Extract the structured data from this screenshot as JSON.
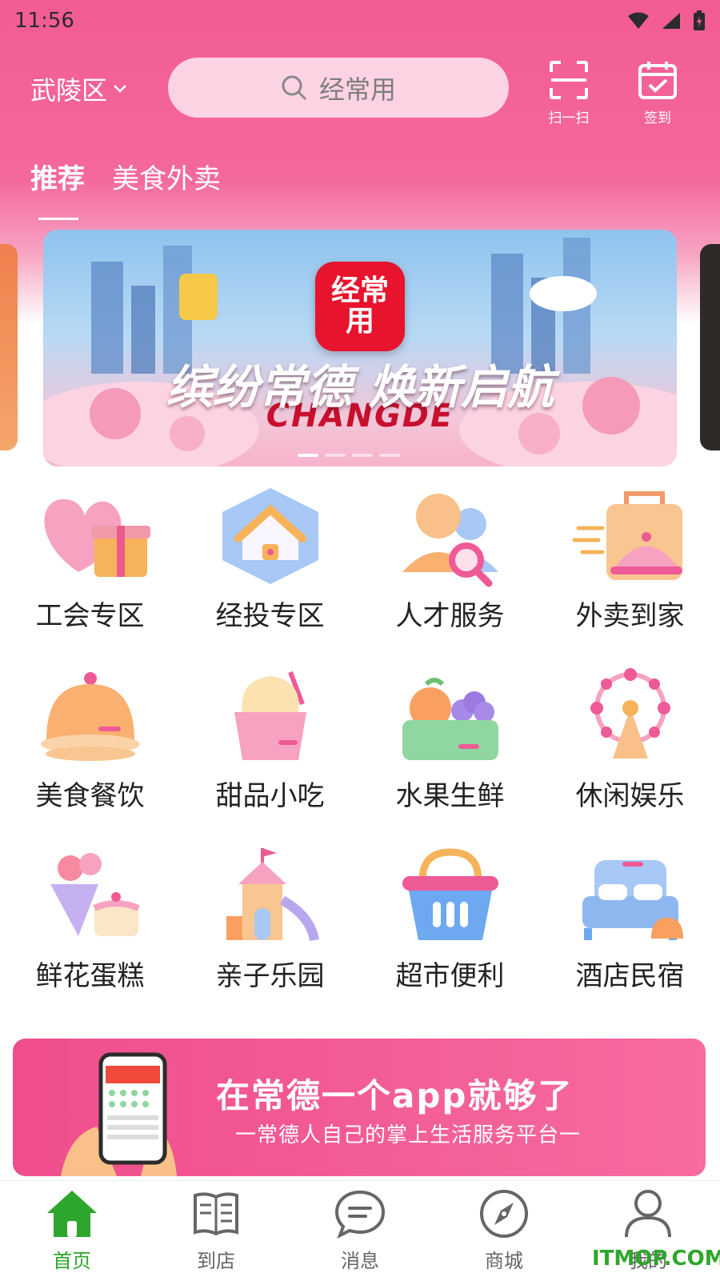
{
  "status": {
    "time": "11:56"
  },
  "header": {
    "district": "武陵区",
    "search_placeholder": "经常用",
    "scan_label": "扫一扫",
    "checkin_label": "签到"
  },
  "tabs": [
    {
      "label": "推荐",
      "active": true
    },
    {
      "label": "美食外卖",
      "active": false
    }
  ],
  "banner": {
    "logo_text": "经常用",
    "headline": "缤纷常德 焕新启航",
    "sub": "CHANGDE",
    "page": 1,
    "page_count": 4
  },
  "categories": [
    {
      "label": "工会专区",
      "icon": "heart-gift-icon"
    },
    {
      "label": "经投专区",
      "icon": "house-icon"
    },
    {
      "label": "人才服务",
      "icon": "people-search-icon"
    },
    {
      "label": "外卖到家",
      "icon": "delivery-bag-icon"
    },
    {
      "label": "美食餐饮",
      "icon": "food-cloche-icon"
    },
    {
      "label": "甜品小吃",
      "icon": "ice-cream-icon"
    },
    {
      "label": "水果生鲜",
      "icon": "fruit-basket-icon"
    },
    {
      "label": "休闲娱乐",
      "icon": "ferris-wheel-icon"
    },
    {
      "label": "鲜花蛋糕",
      "icon": "flower-cake-icon"
    },
    {
      "label": "亲子乐园",
      "icon": "playground-icon"
    },
    {
      "label": "超市便利",
      "icon": "shopping-basket-icon"
    },
    {
      "label": "酒店民宿",
      "icon": "bed-icon"
    }
  ],
  "promo": {
    "title": "在常德一个app就够了",
    "subtitle": "一常德人自己的掌上生活服务平台一"
  },
  "nav": [
    {
      "label": "首页",
      "icon": "home-icon",
      "active": true
    },
    {
      "label": "到店",
      "icon": "book-icon",
      "active": false
    },
    {
      "label": "消息",
      "icon": "message-icon",
      "active": false
    },
    {
      "label": "商城",
      "icon": "compass-icon",
      "active": false
    },
    {
      "label": "我的",
      "icon": "user-icon",
      "active": false
    }
  ],
  "watermark": "ITMOP.COM",
  "colors": {
    "brand_pink": "#f25c93",
    "active_green": "#2ea52c"
  }
}
